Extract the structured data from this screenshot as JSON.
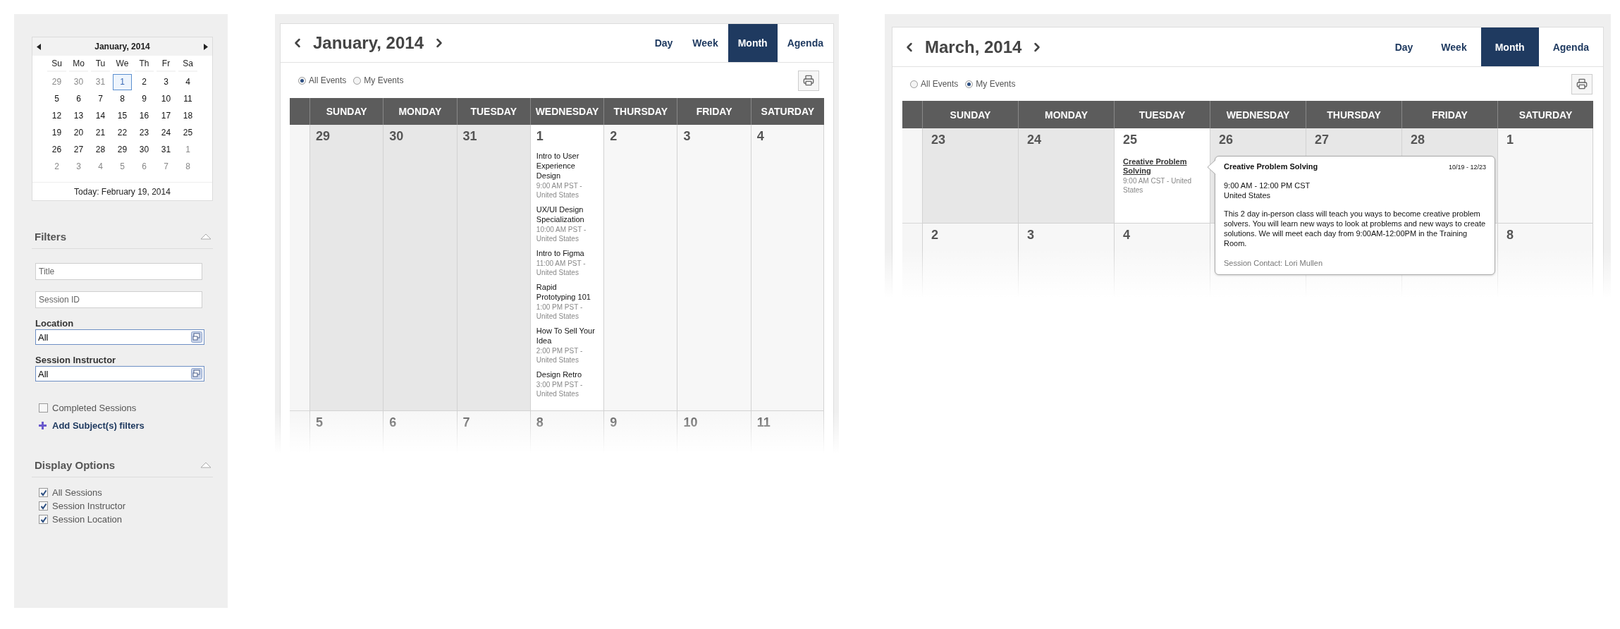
{
  "sidebar": {
    "mini_calendar": {
      "month_label": "January, 2014",
      "weekdays": [
        "Su",
        "Mo",
        "Tu",
        "We",
        "Th",
        "Fr",
        "Sa"
      ],
      "weeks": [
        [
          {
            "day": "29",
            "muted": true,
            "selected": false
          },
          {
            "day": "30",
            "muted": true,
            "selected": false
          },
          {
            "day": "31",
            "muted": true,
            "selected": false
          },
          {
            "day": "1",
            "muted": false,
            "selected": true
          },
          {
            "day": "2",
            "muted": false,
            "selected": false
          },
          {
            "day": "3",
            "muted": false,
            "selected": false
          },
          {
            "day": "4",
            "muted": false,
            "selected": false
          }
        ],
        [
          {
            "day": "5",
            "muted": false,
            "selected": false
          },
          {
            "day": "6",
            "muted": false,
            "selected": false
          },
          {
            "day": "7",
            "muted": false,
            "selected": false
          },
          {
            "day": "8",
            "muted": false,
            "selected": false
          },
          {
            "day": "9",
            "muted": false,
            "selected": false
          },
          {
            "day": "10",
            "muted": false,
            "selected": false
          },
          {
            "day": "11",
            "muted": false,
            "selected": false
          }
        ],
        [
          {
            "day": "12",
            "muted": false,
            "selected": false
          },
          {
            "day": "13",
            "muted": false,
            "selected": false
          },
          {
            "day": "14",
            "muted": false,
            "selected": false
          },
          {
            "day": "15",
            "muted": false,
            "selected": false
          },
          {
            "day": "16",
            "muted": false,
            "selected": false
          },
          {
            "day": "17",
            "muted": false,
            "selected": false
          },
          {
            "day": "18",
            "muted": false,
            "selected": false
          }
        ],
        [
          {
            "day": "19",
            "muted": false,
            "selected": false
          },
          {
            "day": "20",
            "muted": false,
            "selected": false
          },
          {
            "day": "21",
            "muted": false,
            "selected": false
          },
          {
            "day": "22",
            "muted": false,
            "selected": false
          },
          {
            "day": "23",
            "muted": false,
            "selected": false
          },
          {
            "day": "24",
            "muted": false,
            "selected": false
          },
          {
            "day": "25",
            "muted": false,
            "selected": false
          }
        ],
        [
          {
            "day": "26",
            "muted": false,
            "selected": false
          },
          {
            "day": "27",
            "muted": false,
            "selected": false
          },
          {
            "day": "28",
            "muted": false,
            "selected": false
          },
          {
            "day": "29",
            "muted": false,
            "selected": false
          },
          {
            "day": "30",
            "muted": false,
            "selected": false
          },
          {
            "day": "31",
            "muted": false,
            "selected": false
          },
          {
            "day": "1",
            "muted": true,
            "selected": false
          }
        ],
        [
          {
            "day": "2",
            "muted": true,
            "selected": false
          },
          {
            "day": "3",
            "muted": true,
            "selected": false
          },
          {
            "day": "4",
            "muted": true,
            "selected": false
          },
          {
            "day": "5",
            "muted": true,
            "selected": false
          },
          {
            "day": "6",
            "muted": true,
            "selected": false
          },
          {
            "day": "7",
            "muted": true,
            "selected": false
          },
          {
            "day": "8",
            "muted": true,
            "selected": false
          }
        ]
      ],
      "today": "Today: February 19, 2014"
    },
    "filters": {
      "heading": "Filters",
      "expanded": true,
      "fields": [
        {
          "placeholder": "Title"
        },
        {
          "placeholder": "Session ID"
        }
      ],
      "selects": [
        {
          "label": "Location",
          "value": "All"
        },
        {
          "label": "Session Instructor",
          "value": "All"
        }
      ],
      "checkbox": {
        "label": "Completed Sessions",
        "checked": false
      },
      "add_link": "Add Subject(s) filters"
    },
    "display_options": {
      "heading": "Display Options",
      "expanded": true,
      "options": [
        {
          "label": "All Sessions",
          "checked": true
        },
        {
          "label": "Session Instructor",
          "checked": true
        },
        {
          "label": "Session Location",
          "checked": true
        }
      ]
    }
  },
  "calendars": [
    {
      "title": "January, 2014",
      "views": [
        {
          "label": "Day",
          "selected": false
        },
        {
          "label": "Week",
          "selected": false
        },
        {
          "label": "Month",
          "selected": true
        },
        {
          "label": "Agenda",
          "selected": false
        }
      ],
      "event_filters": [
        {
          "label": "All Events",
          "selected": true
        },
        {
          "label": "My Events",
          "selected": false
        }
      ],
      "weekdays": [
        "SUNDAY",
        "MONDAY",
        "TUESDAY",
        "WEDNESDAY",
        "THURSDAY",
        "FRIDAY",
        "SATURDAY"
      ],
      "weeks": [
        {
          "days": [
            {
              "day": "29",
              "kind": "past"
            },
            {
              "day": "30",
              "kind": "past"
            },
            {
              "day": "31",
              "kind": "past"
            },
            {
              "day": "1",
              "kind": "active",
              "events": [
                {
                  "kind": "plain",
                  "title": "Intro to User Experience Design",
                  "detail": "9:00 AM PST - United States"
                },
                {
                  "kind": "plain",
                  "title": "UX/UI Design Specialization",
                  "detail": "10:00 AM PST - United States"
                },
                {
                  "kind": "plain",
                  "title": "Intro to Figma",
                  "detail": "11:00 AM PST - United States"
                },
                {
                  "kind": "plain",
                  "title": "Rapid Prototyping 101",
                  "detail": "1:00 PM PST - United States"
                },
                {
                  "kind": "plain",
                  "title": "How To Sell Your Idea",
                  "detail": "2:00 PM PST - United States"
                },
                {
                  "kind": "plain",
                  "title": "Design Retro",
                  "detail": "3:00 PM PST - United States"
                }
              ]
            },
            {
              "day": "2",
              "kind": "future"
            },
            {
              "day": "3",
              "kind": "future"
            },
            {
              "day": "4",
              "kind": "future"
            }
          ]
        },
        {
          "days": [
            {
              "day": "5",
              "kind": "future"
            },
            {
              "day": "6",
              "kind": "future"
            },
            {
              "day": "7",
              "kind": "future"
            },
            {
              "day": "8",
              "kind": "future"
            },
            {
              "day": "9",
              "kind": "future"
            },
            {
              "day": "10",
              "kind": "future"
            },
            {
              "day": "11",
              "kind": "future"
            }
          ]
        }
      ]
    },
    {
      "title": "March, 2014",
      "views": [
        {
          "label": "Day",
          "selected": false
        },
        {
          "label": "Week",
          "selected": false
        },
        {
          "label": "Month",
          "selected": true
        },
        {
          "label": "Agenda",
          "selected": false
        }
      ],
      "event_filters": [
        {
          "label": "All Events",
          "selected": false
        },
        {
          "label": "My Events",
          "selected": true
        }
      ],
      "weekdays": [
        "SUNDAY",
        "MONDAY",
        "TUESDAY",
        "WEDNESDAY",
        "THURSDAY",
        "FRIDAY",
        "SATURDAY"
      ],
      "weeks": [
        {
          "days": [
            {
              "day": "23",
              "kind": "past"
            },
            {
              "day": "24",
              "kind": "past"
            },
            {
              "day": "25",
              "kind": "active",
              "events": [
                {
                  "kind": "link",
                  "title": "Creative Problem Solving",
                  "detail": "9:00 AM CST - United States"
                }
              ]
            },
            {
              "day": "26",
              "kind": "past"
            },
            {
              "day": "27",
              "kind": "past"
            },
            {
              "day": "28",
              "kind": "past"
            },
            {
              "day": "1",
              "kind": "future"
            }
          ]
        },
        {
          "days": [
            {
              "day": "2",
              "kind": "future"
            },
            {
              "day": "3",
              "kind": "future"
            },
            {
              "day": "4",
              "kind": "future"
            },
            {
              "kind": "future"
            },
            {
              "kind": "future"
            },
            {
              "kind": "future"
            },
            {
              "day": "8",
              "kind": "future"
            }
          ]
        }
      ],
      "tooltip": {
        "title": "Creative Problem Solving",
        "dates": "10/19 - 12/23",
        "time": "9:00 AM - 12:00 PM CST",
        "location": "United States",
        "description": "This 2 day in-person class will teach you ways to become creative problem solvers. You will learn new ways to look at problems and new ways to create solutions. We will meet each day from 9:00AM-12:00PM in the Training Room.",
        "contact": "Session Contact: Lori Mullen"
      }
    }
  ]
}
